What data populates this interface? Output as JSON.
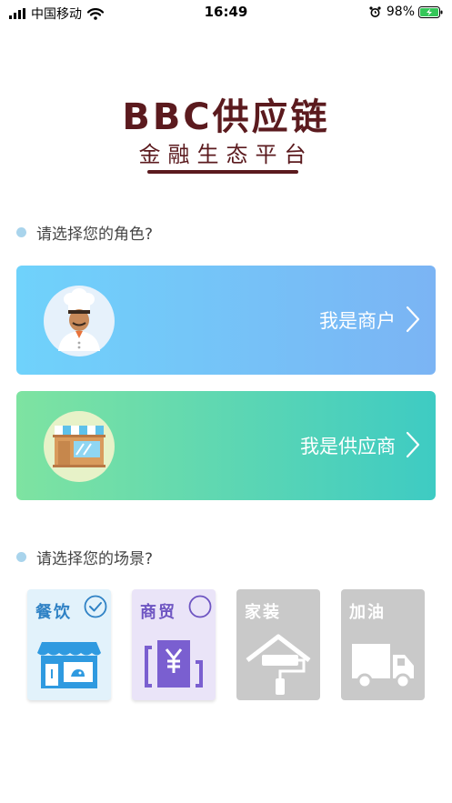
{
  "status_bar": {
    "carrier": "中国移动",
    "time": "16:49",
    "battery": "98%",
    "icons": [
      "signal-icon",
      "wifi-icon",
      "alarm-icon",
      "battery-icon"
    ]
  },
  "header": {
    "title": "BBC供应链",
    "subtitle": "金融生态平台"
  },
  "role_section": {
    "label": "请选择您的角色?",
    "roles": [
      {
        "label": "我是商户",
        "icon": "chef-avatar-icon"
      },
      {
        "label": "我是供应商",
        "icon": "storefront-icon"
      }
    ]
  },
  "scene_section": {
    "label": "请选择您的场景?",
    "scenes": [
      {
        "label": "餐饮",
        "icon": "shop-icon",
        "selected": true,
        "accent": "#2f82c5"
      },
      {
        "label": "商贸",
        "icon": "yen-building-icon",
        "selected": false,
        "accent": "#6e55c2"
      },
      {
        "label": "家装",
        "icon": "house-paint-roller-icon",
        "disabled": true
      },
      {
        "label": "加油",
        "icon": "truck-icon",
        "disabled": true
      }
    ]
  },
  "colors": {
    "brand": "#5b1a1e",
    "merchant_gradient": [
      "#6fd2fb",
      "#7bb4f4"
    ],
    "supplier_gradient": [
      "#7ee3a1",
      "#3ecbc3"
    ],
    "dot": "#a9d4ec"
  }
}
